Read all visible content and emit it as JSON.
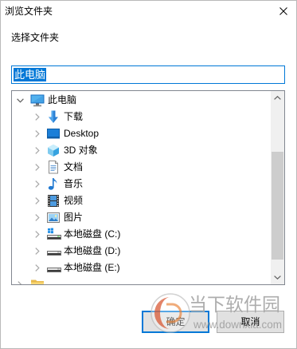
{
  "window": {
    "title": "浏览文件夹",
    "close_icon": "close-icon"
  },
  "prompt_label": "选择文件夹",
  "folder_field": {
    "value": "此电脑",
    "selected": true
  },
  "tree": {
    "root": {
      "label": "此电脑",
      "icon": "computer-icon",
      "expanded": true
    },
    "items": [
      {
        "label": "下载",
        "icon": "downloads-icon"
      },
      {
        "label": "Desktop",
        "icon": "desktop-icon"
      },
      {
        "label": "3D 对象",
        "icon": "3d-objects-icon"
      },
      {
        "label": "文档",
        "icon": "documents-icon"
      },
      {
        "label": "音乐",
        "icon": "music-icon"
      },
      {
        "label": "视频",
        "icon": "videos-icon"
      },
      {
        "label": "图片",
        "icon": "pictures-icon"
      },
      {
        "label": "本地磁盘 (C:)",
        "icon": "system-drive-icon"
      },
      {
        "label": "本地磁盘 (D:)",
        "icon": "drive-icon"
      },
      {
        "label": "本地磁盘 (E:)",
        "icon": "drive-icon"
      }
    ],
    "clipped_item": {
      "icon": "folder-icon",
      "expanded": false
    }
  },
  "buttons": {
    "ok": {
      "label": "确定",
      "is_default": true
    },
    "cancel": {
      "label": "取消"
    }
  },
  "watermark": {
    "name": "当下软件园",
    "url": "www.downxia.com",
    "logo_icon": "downxia-logo-icon"
  },
  "colors": {
    "accent": "#0078d7",
    "selection_text": "#ffffff",
    "button_face": "#e1e1e1",
    "button_border": "#adadad",
    "tree_border": "#828790",
    "scrollbar_thumb": "#cdcdcd",
    "scrollbar_track": "#f0f0f0"
  }
}
